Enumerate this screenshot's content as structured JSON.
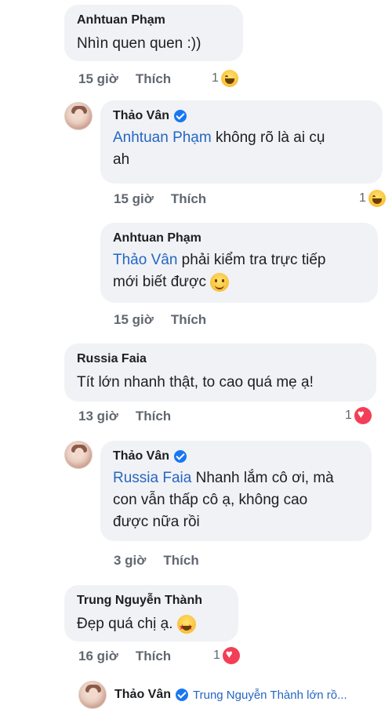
{
  "comments": [
    {
      "author": "Anhtuan Phạm",
      "text": "Nhìn quen quen :))",
      "time": "15 giờ",
      "like": "Thích",
      "reaction_count": "1",
      "reaction": "haha"
    },
    {
      "author": "Thảo Vân",
      "verified": true,
      "mention": "Anhtuan Phạm",
      "text_line1": " không rõ là ai cụ",
      "text_line2": "ah",
      "time": "15 giờ",
      "like": "Thích",
      "reaction_count": "1",
      "reaction": "haha"
    },
    {
      "author": "Anhtuan Phạm",
      "mention": "Thảo Vân",
      "text_line1": "  phải kiểm tra trực tiếp",
      "text_line2": "mới biết được",
      "inline_emoji": "slightly-smiling",
      "time": "15 giờ",
      "like": "Thích"
    },
    {
      "author": "Russia Faia",
      "text": "Tít lớn nhanh thật, to cao quá mẹ ạ!",
      "time": "13 giờ",
      "like": "Thích",
      "reaction_count": "1",
      "reaction": "love"
    },
    {
      "author": "Thảo Vân",
      "verified": true,
      "mention": "Russia Faia",
      "text_line1": " Nhanh lắm cô ơi, mà",
      "text_line2": "con vẫn thấp cô ạ, không cao",
      "text_line3": "được nữa rồi",
      "time": "3 giờ",
      "like": "Thích"
    },
    {
      "author": "Trung Nguyễn Thành",
      "text": "Đẹp quá chị ạ.",
      "inline_emoji": "star-struck",
      "time": "16 giờ",
      "like": "Thích",
      "reaction_count": "1",
      "reaction": "love"
    }
  ],
  "collapsed_reply": {
    "author": "Thảo Vân",
    "verified": true,
    "preview": "Trung Nguyễn Thành lớn rồ..."
  },
  "colors": {
    "bubble": "#f0f2f5",
    "mention": "#2566c4",
    "meta": "#606770",
    "verified": "#1877f2",
    "love": "#f33e58"
  }
}
